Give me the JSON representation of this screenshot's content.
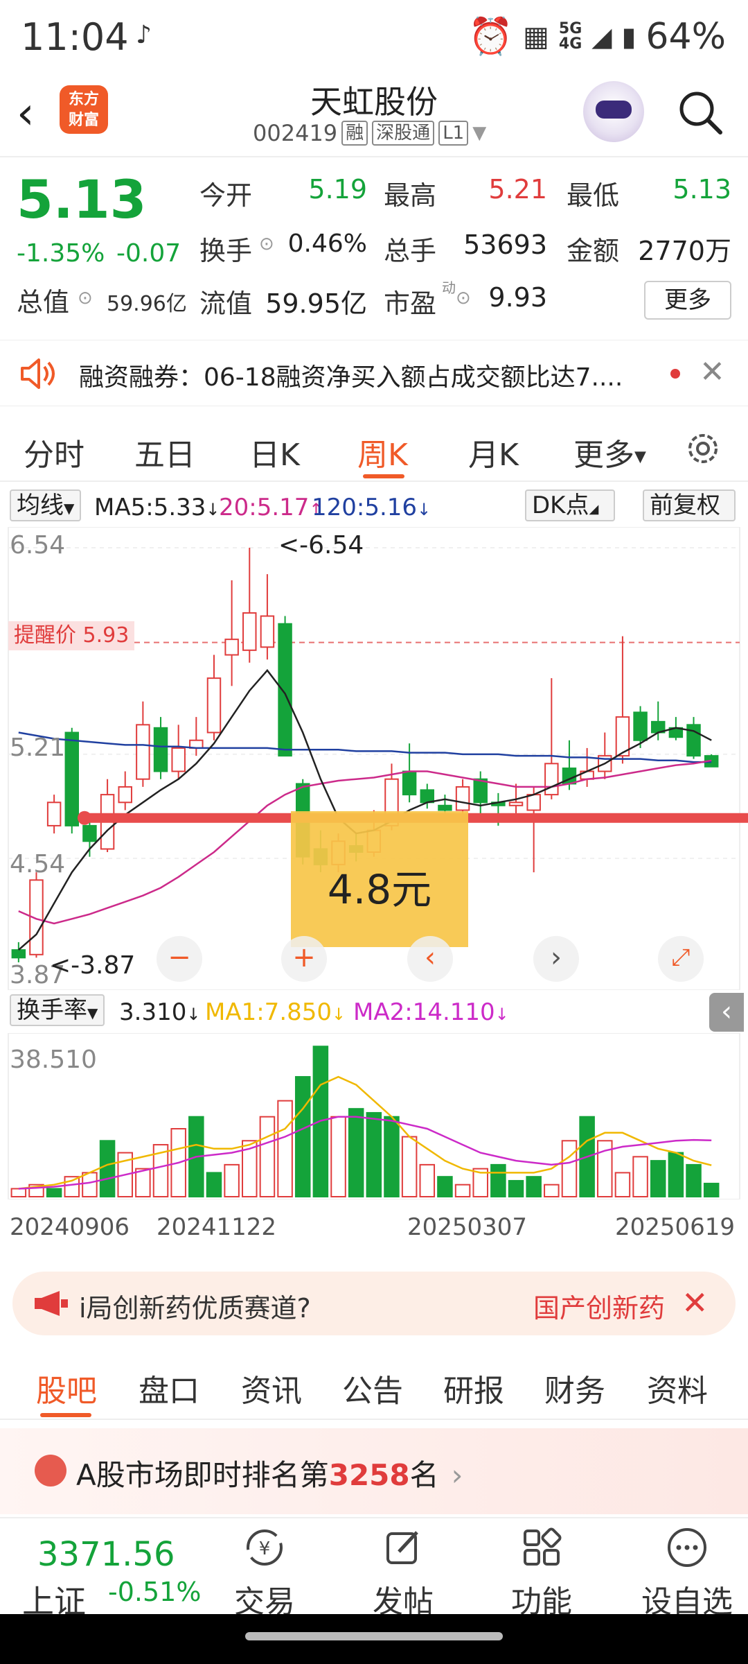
{
  "status_bar": {
    "time": "11:04",
    "network_top": "5G",
    "network_bottom": "4G",
    "battery": "64%"
  },
  "header": {
    "logo_line1": "东方",
    "logo_line2": "财富",
    "title": "天虹股份",
    "code": "002419",
    "tag1": "融",
    "tag2": "深股通",
    "tag3": "L1"
  },
  "quote": {
    "price": "5.13",
    "change_pct": "-1.35%",
    "change": "-0.07",
    "open_label": "今开",
    "open": "5.19",
    "high_label": "最高",
    "high": "5.21",
    "low_label": "最低",
    "low": "5.13",
    "turnover_label": "换手",
    "turnover": "0.46%",
    "volume_label": "总手",
    "volume": "53693",
    "amount_label": "金额",
    "amount": "2770万",
    "total_mv_label": "总值",
    "total_mv": "59.96亿",
    "float_mv_label": "流值",
    "float_mv": "59.95亿",
    "pe_label": "市盈",
    "pe_sup": "动",
    "pe": "9.93",
    "more": "更多"
  },
  "news": {
    "text": "融资融券：06-18融资净买入额占成交额比达7...."
  },
  "kline_tabs": [
    "分时",
    "五日",
    "日K",
    "周K",
    "月K",
    "更多"
  ],
  "ma_bar": {
    "type": "均线",
    "ma5": "MA5:5.33",
    "ma5_arrow": "↓",
    "ma20": "20:5.17",
    "ma20_arrow": "↑",
    "ma120": "120:5.16",
    "ma120_arrow": "↓",
    "dk": "DK点",
    "adjust": "前复权"
  },
  "chart_labels": {
    "high": "6.54",
    "mid": "5.21",
    "low": "4.54",
    "bottom": "3.87",
    "alert": "提醒价 5.93",
    "max_marker": "<-6.54",
    "min_marker": "<-3.87",
    "dk_price": "4.8元"
  },
  "controls": {
    "minus": "−",
    "plus": "+",
    "prev": "‹",
    "next": "›"
  },
  "sub_bar": {
    "type": "换手率",
    "value": "3.310",
    "value_arrow": "↓",
    "ma1": "MA1:7.850",
    "ma1_arrow": "↓",
    "ma2": "MA2:14.110",
    "ma2_arrow": "↓",
    "max": "38.510"
  },
  "dates": [
    "20240906",
    "20241122",
    "20250307",
    "20250619"
  ],
  "promo": {
    "text": "i局创新药优质赛道?",
    "text2": "国产创新药"
  },
  "bottom_tabs": [
    "股吧",
    "盘口",
    "资讯",
    "公告",
    "研报",
    "财务",
    "资料"
  ],
  "rank": {
    "prefix": "A股市场即时排名第",
    "number": "3258",
    "suffix": "名"
  },
  "index": {
    "value": "3371.56",
    "name": "上证",
    "change": "-0.51%"
  },
  "nav": [
    "交易",
    "发帖",
    "功能",
    "设自选"
  ],
  "colors": {
    "up": "#e03c3c",
    "down": "#14a33a",
    "accent": "#f05a28",
    "ma5": "#222222",
    "ma20": "#cc2a8a",
    "ma120": "#2040a0",
    "ma1": "#f0b800",
    "ma2": "#cc2ac8"
  },
  "chart_data": [
    {
      "type": "candlestick",
      "title": "周K",
      "ylim": [
        3.87,
        6.54
      ],
      "candles": [
        {
          "o": 3.95,
          "c": 3.9,
          "h": 4.0,
          "l": 3.87
        },
        {
          "o": 3.92,
          "c": 4.4,
          "h": 4.45,
          "l": 3.9
        },
        {
          "o": 4.75,
          "c": 4.9,
          "h": 4.95,
          "l": 4.7
        },
        {
          "o": 5.35,
          "c": 4.75,
          "h": 5.38,
          "l": 4.7
        },
        {
          "o": 4.75,
          "c": 4.65,
          "h": 4.8,
          "l": 4.55
        },
        {
          "o": 4.6,
          "c": 4.95,
          "h": 5.05,
          "l": 4.58
        },
        {
          "o": 4.9,
          "c": 5.0,
          "h": 5.1,
          "l": 4.85
        },
        {
          "o": 5.05,
          "c": 5.4,
          "h": 5.55,
          "l": 5.0
        },
        {
          "o": 5.38,
          "c": 5.1,
          "h": 5.45,
          "l": 5.05
        },
        {
          "o": 5.1,
          "c": 5.25,
          "h": 5.4,
          "l": 5.05
        },
        {
          "o": 5.25,
          "c": 5.3,
          "h": 5.45,
          "l": 5.2
        },
        {
          "o": 5.35,
          "c": 5.7,
          "h": 5.85,
          "l": 5.3
        },
        {
          "o": 5.85,
          "c": 5.95,
          "h": 6.33,
          "l": 5.65
        },
        {
          "o": 5.88,
          "c": 6.12,
          "h": 6.54,
          "l": 5.8
        },
        {
          "o": 5.9,
          "c": 6.1,
          "h": 6.37,
          "l": 5.82
        },
        {
          "o": 6.05,
          "c": 5.2,
          "h": 6.1,
          "l": 5.2
        },
        {
          "o": 5.02,
          "c": 4.55,
          "h": 5.05,
          "l": 4.5
        },
        {
          "o": 4.6,
          "c": 4.5,
          "h": 4.72,
          "l": 4.45
        },
        {
          "o": 4.5,
          "c": 4.65,
          "h": 4.7,
          "l": 4.45
        },
        {
          "o": 4.62,
          "c": 4.58,
          "h": 4.7,
          "l": 4.52
        },
        {
          "o": 4.58,
          "c": 4.72,
          "h": 4.85,
          "l": 4.55
        },
        {
          "o": 4.75,
          "c": 5.05,
          "h": 5.15,
          "l": 4.72
        },
        {
          "o": 5.1,
          "c": 4.95,
          "h": 5.28,
          "l": 4.9
        },
        {
          "o": 4.98,
          "c": 4.9,
          "h": 5.02,
          "l": 4.86
        },
        {
          "o": 4.88,
          "c": 4.85,
          "h": 4.95,
          "l": 4.8
        },
        {
          "o": 4.85,
          "c": 5.0,
          "h": 5.05,
          "l": 4.8
        },
        {
          "o": 5.05,
          "c": 4.9,
          "h": 5.1,
          "l": 4.82
        },
        {
          "o": 4.9,
          "c": 4.88,
          "h": 4.96,
          "l": 4.75
        },
        {
          "o": 4.88,
          "c": 4.9,
          "h": 5.02,
          "l": 4.78
        },
        {
          "o": 4.85,
          "c": 4.95,
          "h": 5.0,
          "l": 4.45
        },
        {
          "o": 4.95,
          "c": 5.15,
          "h": 5.7,
          "l": 4.92
        },
        {
          "o": 5.12,
          "c": 5.02,
          "h": 5.3,
          "l": 4.98
        },
        {
          "o": 5.05,
          "c": 5.1,
          "h": 5.25,
          "l": 5.0
        },
        {
          "o": 5.1,
          "c": 5.2,
          "h": 5.35,
          "l": 5.05
        },
        {
          "o": 5.2,
          "c": 5.45,
          "h": 5.97,
          "l": 5.15
        },
        {
          "o": 5.48,
          "c": 5.3,
          "h": 5.52,
          "l": 5.25
        },
        {
          "o": 5.42,
          "c": 5.35,
          "h": 5.55,
          "l": 5.3
        },
        {
          "o": 5.38,
          "c": 5.32,
          "h": 5.45,
          "l": 5.3
        },
        {
          "o": 5.4,
          "c": 5.2,
          "h": 5.45,
          "l": 5.18
        },
        {
          "o": 5.2,
          "c": 5.13,
          "h": 5.21,
          "l": 5.13
        }
      ],
      "ma5": [
        3.95,
        4.05,
        4.25,
        4.45,
        4.6,
        4.72,
        4.82,
        4.9,
        4.98,
        5.05,
        5.15,
        5.28,
        5.45,
        5.62,
        5.75,
        5.6,
        5.35,
        5.05,
        4.8,
        4.7,
        4.72,
        4.78,
        4.85,
        4.9,
        4.92,
        4.9,
        4.88,
        4.9,
        4.92,
        4.95,
        5.0,
        5.05,
        5.1,
        5.15,
        5.22,
        5.28,
        5.35,
        5.38,
        5.36,
        5.3
      ],
      "ma20": [
        4.2,
        4.15,
        4.12,
        4.15,
        4.18,
        4.22,
        4.26,
        4.3,
        4.35,
        4.42,
        4.5,
        4.58,
        4.68,
        4.78,
        4.88,
        4.95,
        5.0,
        5.02,
        5.04,
        5.05,
        5.06,
        5.08,
        5.1,
        5.1,
        5.08,
        5.06,
        5.04,
        5.02,
        5.0,
        5.0,
        5.0,
        5.02,
        5.05,
        5.06,
        5.08,
        5.1,
        5.12,
        5.14,
        5.15,
        5.17
      ],
      "ma120": [
        5.35,
        5.33,
        5.31,
        5.3,
        5.29,
        5.28,
        5.27,
        5.27,
        5.26,
        5.26,
        5.25,
        5.25,
        5.25,
        5.25,
        5.25,
        5.24,
        5.24,
        5.24,
        5.24,
        5.23,
        5.23,
        5.23,
        5.22,
        5.22,
        5.22,
        5.21,
        5.21,
        5.21,
        5.2,
        5.2,
        5.2,
        5.19,
        5.19,
        5.18,
        5.18,
        5.18,
        5.17,
        5.17,
        5.16,
        5.16
      ],
      "drawn_level": 4.8,
      "alert_level": 5.93
    },
    {
      "type": "bar",
      "title": "换手率",
      "ylim": [
        0,
        38.51
      ],
      "values": [
        2,
        3,
        2,
        5,
        6,
        14,
        11,
        7,
        13,
        17,
        20,
        6,
        8,
        14,
        20,
        24,
        30,
        37.6,
        20,
        22,
        21,
        20,
        15,
        8,
        5,
        3,
        7,
        8,
        4,
        5,
        3,
        14,
        20,
        14,
        6,
        10,
        9,
        11,
        8,
        3.31
      ],
      "up": [
        true,
        true,
        false,
        true,
        true,
        false,
        true,
        true,
        true,
        true,
        false,
        false,
        true,
        true,
        true,
        true,
        false,
        false,
        true,
        false,
        false,
        false,
        true,
        true,
        false,
        true,
        true,
        false,
        false,
        false,
        true,
        true,
        false,
        true,
        true,
        true,
        false,
        false,
        false,
        false
      ],
      "ma1": [
        2,
        2.5,
        3,
        4,
        6,
        8,
        9,
        10,
        11,
        12,
        13,
        12,
        12,
        13,
        15,
        17,
        22,
        28,
        30,
        28,
        24,
        20,
        15,
        12,
        9,
        7,
        6,
        6,
        6,
        6,
        7,
        10,
        14,
        16,
        16,
        14,
        12,
        11,
        9,
        7.85
      ],
      "ma2": [
        2,
        2.2,
        2.5,
        3,
        3.5,
        4.5,
        5.5,
        6.5,
        7.5,
        8.5,
        10,
        10.5,
        11,
        12,
        13.5,
        15,
        17,
        19,
        20,
        20,
        19.5,
        19,
        18,
        17,
        15,
        13,
        11,
        10,
        9,
        8.5,
        8,
        8.5,
        10,
        11.5,
        12.5,
        13,
        13.5,
        14,
        14.2,
        14.11
      ]
    }
  ]
}
